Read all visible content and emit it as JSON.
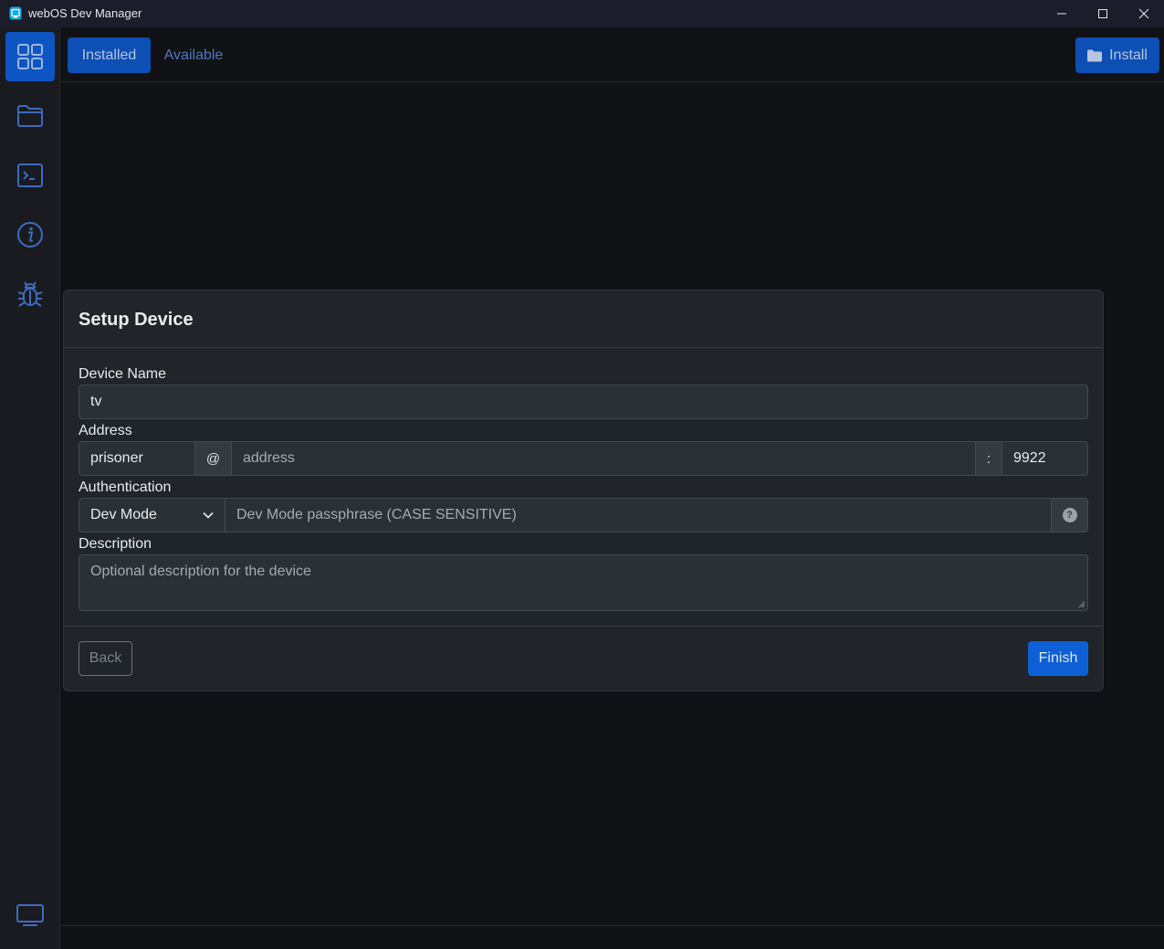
{
  "window": {
    "title": "webOS Dev Manager"
  },
  "sidebar": {
    "items": [
      {
        "name": "apps",
        "icon": "grid-icon",
        "active": true
      },
      {
        "name": "files",
        "icon": "folder-icon",
        "active": false
      },
      {
        "name": "terminal",
        "icon": "terminal-icon",
        "active": false
      },
      {
        "name": "info",
        "icon": "info-icon",
        "active": false
      },
      {
        "name": "debug",
        "icon": "bug-icon",
        "active": false
      }
    ],
    "bottom_icon": "monitor-icon"
  },
  "topbar": {
    "tabs": [
      {
        "label": "Installed",
        "active": true
      },
      {
        "label": "Available",
        "active": false
      }
    ],
    "install_label": "Install"
  },
  "modal": {
    "title": "Setup Device",
    "device_name_label": "Device Name",
    "device_name_value": "tv",
    "address_label": "Address",
    "username_value": "prisoner",
    "at_symbol": "@",
    "address_placeholder": "address",
    "colon_symbol": ":",
    "port_value": "9922",
    "auth_label": "Authentication",
    "auth_selected": "Dev Mode",
    "passphrase_placeholder": "Dev Mode passphrase (CASE SENSITIVE)",
    "help_symbol": "?",
    "description_label": "Description",
    "description_placeholder": "Optional description for the device",
    "back_label": "Back",
    "finish_label": "Finish"
  },
  "colors": {
    "accent": "#0d5fd6",
    "background": "#101215",
    "modal_bg": "#212429"
  }
}
